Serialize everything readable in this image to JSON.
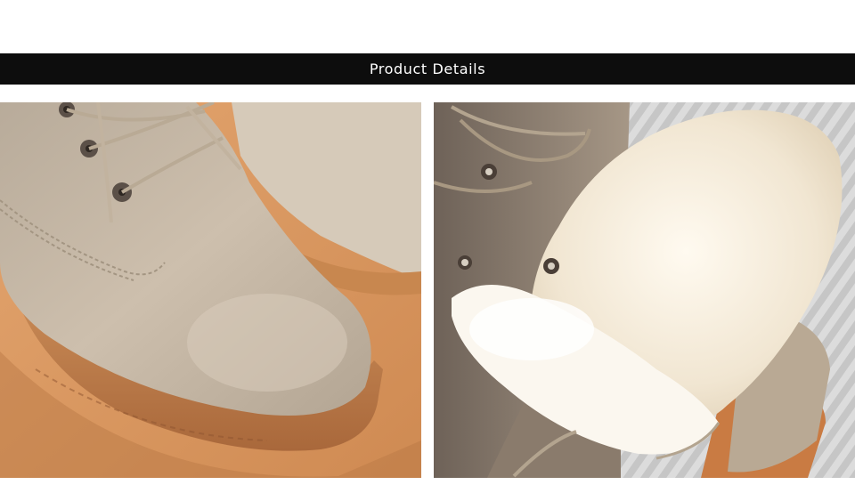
{
  "header": {
    "title": "Product Details"
  },
  "images": [
    {
      "name": "suede-boot-toe-closeup",
      "description_icon": "boot-toe-image"
    },
    {
      "name": "wool-lined-boot-interior",
      "description_icon": "boot-lining-image"
    }
  ],
  "colors": {
    "banner_bg": "#0d0d0d",
    "banner_text": "#ffffff",
    "page_bg": "#ffffff",
    "suede": "#c9bba8",
    "sole": "#c98a55",
    "backdrop": "#d99a63",
    "wool": "#f3eadc"
  }
}
